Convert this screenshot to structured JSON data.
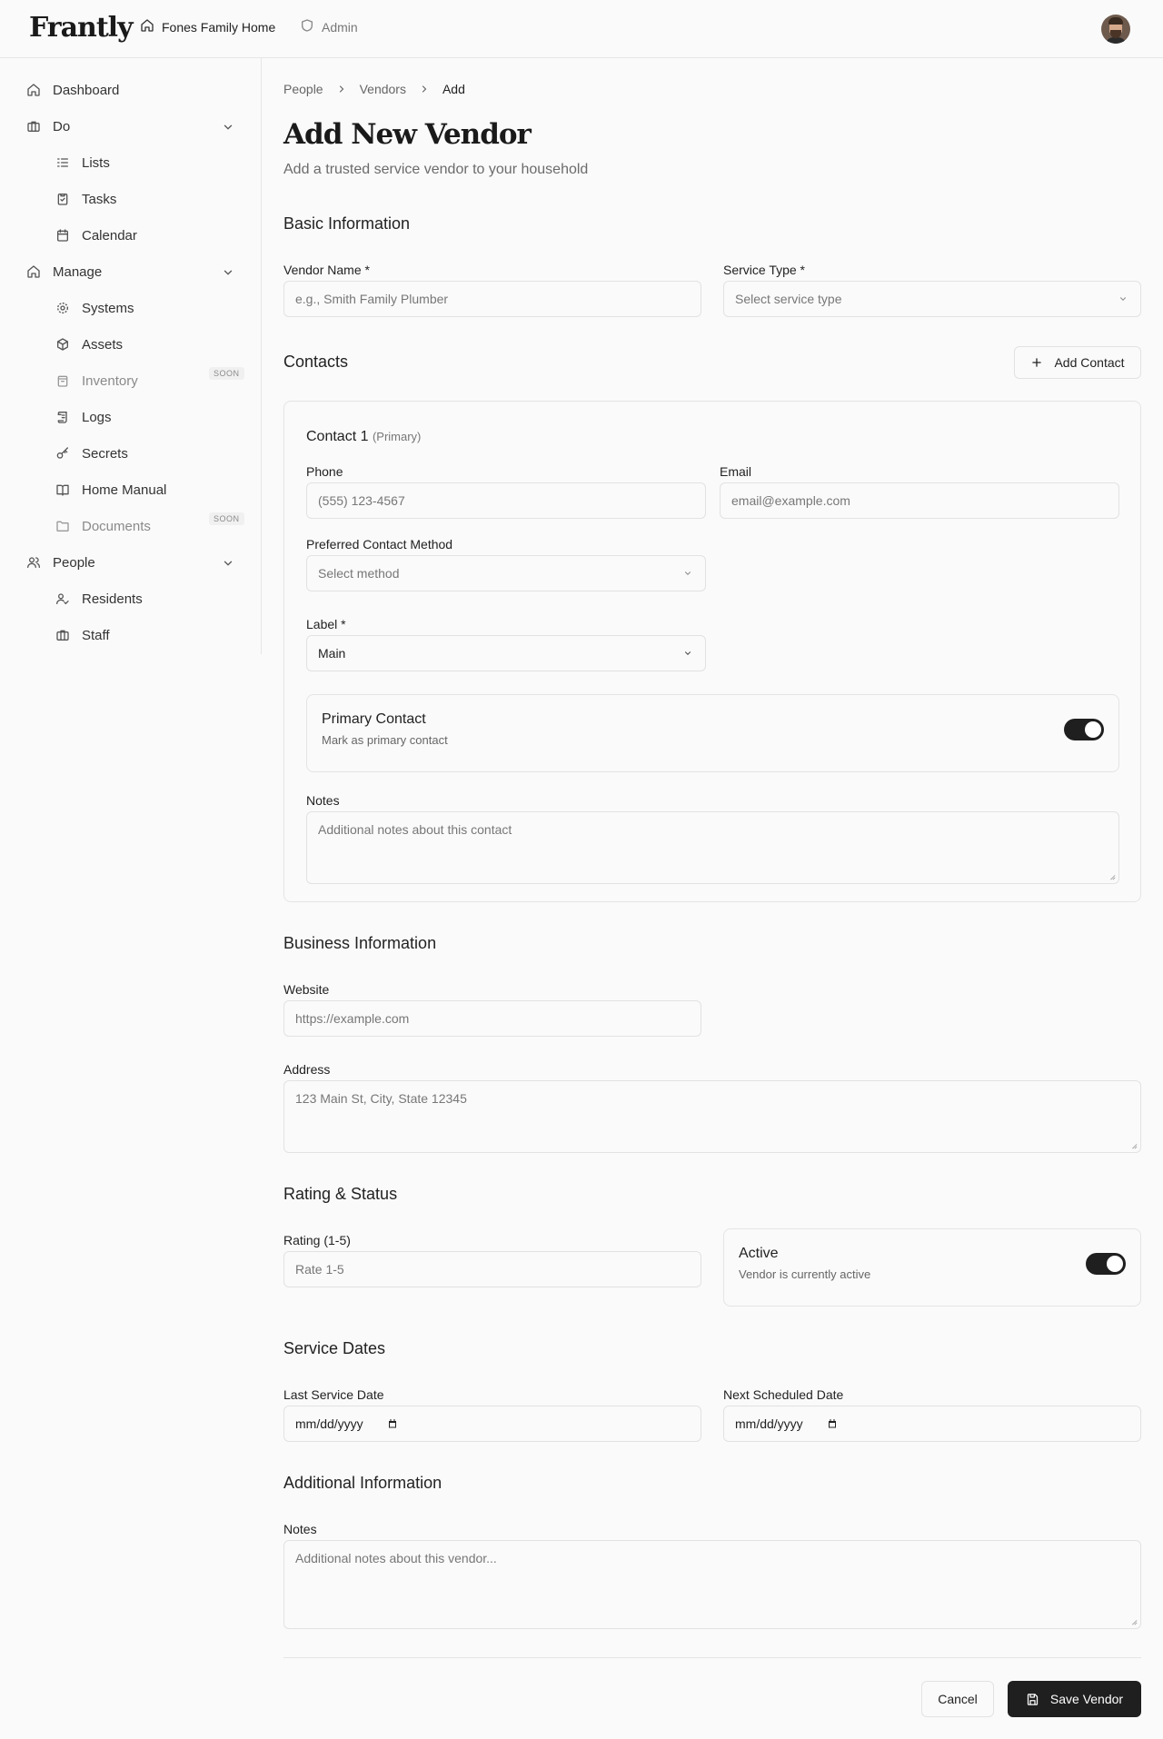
{
  "app": {
    "logo": "Frantly",
    "household": "Fones Family Home",
    "admin": "Admin"
  },
  "sidebar": {
    "dashboard": "Dashboard",
    "do": "Do",
    "do_items": [
      "Lists",
      "Tasks",
      "Calendar"
    ],
    "manage": "Manage",
    "manage_items": [
      "Systems",
      "Assets",
      "Inventory",
      "Logs",
      "Secrets",
      "Home Manual",
      "Documents"
    ],
    "soon": "SOON",
    "people": "People",
    "people_items": [
      "Residents",
      "Staff"
    ]
  },
  "breadcrumb": [
    "People",
    "Vendors",
    "Add"
  ],
  "page": {
    "title": "Add New Vendor",
    "subtitle": "Add a trusted service vendor to your household"
  },
  "basic": {
    "heading": "Basic Information",
    "vendor_name_label": "Vendor Name *",
    "vendor_name_placeholder": "e.g., Smith Family Plumber",
    "service_type_label": "Service Type *",
    "service_type_placeholder": "Select service type"
  },
  "contacts": {
    "heading": "Contacts",
    "add_button": "Add Contact",
    "contact_title": "Contact 1",
    "contact_primary_tag": "(Primary)",
    "phone_label": "Phone",
    "phone_placeholder": "(555) 123-4567",
    "email_label": "Email",
    "email_placeholder": "email@example.com",
    "method_label": "Preferred Contact Method",
    "method_placeholder": "Select method",
    "label_label": "Label *",
    "label_value": "Main",
    "primary_title": "Primary Contact",
    "primary_desc": "Mark as primary contact",
    "primary_on": true,
    "notes_label": "Notes",
    "notes_placeholder": "Additional notes about this contact"
  },
  "business": {
    "heading": "Business Information",
    "website_label": "Website",
    "website_placeholder": "https://example.com",
    "address_label": "Address",
    "address_placeholder": "123 Main St, City, State 12345"
  },
  "rating": {
    "heading": "Rating & Status",
    "rating_label": "Rating (1-5)",
    "rating_placeholder": "Rate 1-5",
    "active_title": "Active",
    "active_desc": "Vendor is currently active",
    "active_on": true
  },
  "dates": {
    "heading": "Service Dates",
    "last_label": "Last Service Date",
    "next_label": "Next Scheduled Date",
    "date_placeholder": "mm/dd/yyyy"
  },
  "additional": {
    "heading": "Additional Information",
    "notes_label": "Notes",
    "notes_placeholder": "Additional notes about this vendor..."
  },
  "actions": {
    "cancel": "Cancel",
    "save": "Save Vendor"
  }
}
